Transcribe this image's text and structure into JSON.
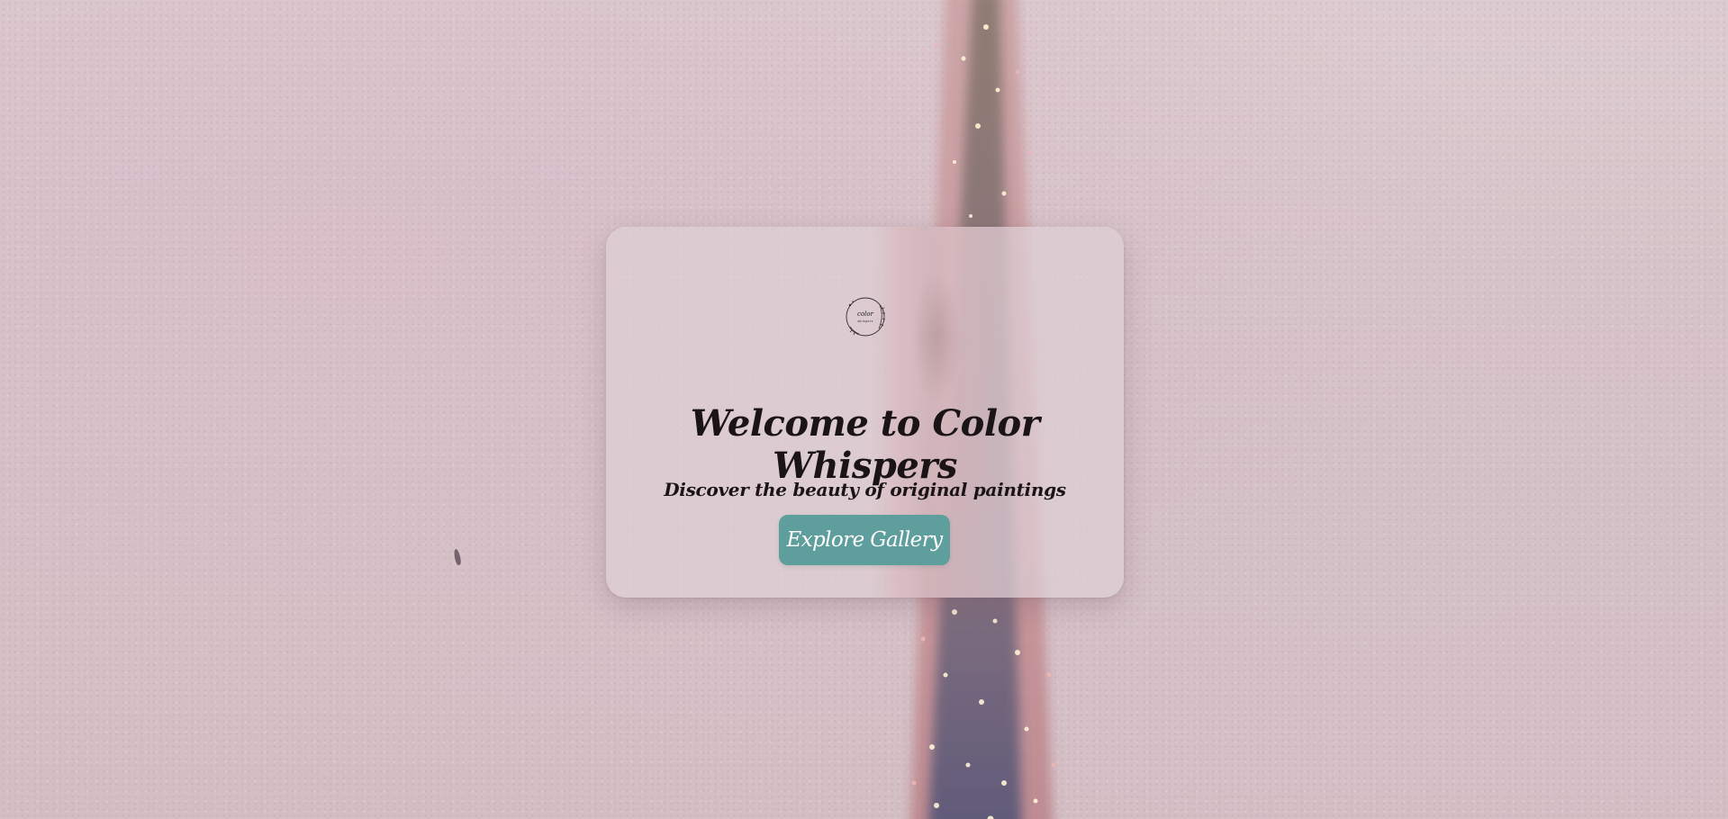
{
  "background": {
    "base_color": "#d8c6cb",
    "subject": "painted-tower-artwork"
  },
  "hero": {
    "logo": {
      "icon": "color-whispers-wreath-logo",
      "line1": "color",
      "line2": "whispers"
    },
    "title": "Welcome to Color Whispers",
    "subtitle": "Discover the beauty of original paintings",
    "cta_label": "Explore Gallery",
    "cta_color": "#5e9e9c"
  }
}
